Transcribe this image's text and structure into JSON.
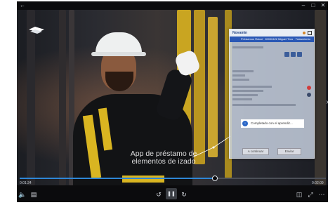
{
  "window": {
    "back_icon": "arrow-left-icon",
    "controls": [
      "minimize-icon",
      "maximize-icon",
      "close-icon"
    ]
  },
  "video": {
    "caption_line1": "App de préstamo de",
    "caption_line2": "elementos de izado",
    "progress": 0.635,
    "time_elapsed": "0:01:24",
    "time_total": "0:02:09",
    "accent_color": "#2e86d6"
  },
  "overlay_app": {
    "brand": "Novamin",
    "header_text": "Préstamos Rukat · 00000422 Miguel Tóro · Tratamiento",
    "notification": "Completado con el aprendiz...",
    "btn_left": "A continuar",
    "btn_right": "Enviar"
  },
  "player_controls": {
    "volume": "volume-icon",
    "subtitles": "subtitles-icon",
    "skip_back": "skip-back-10-icon",
    "play_pause": "pause-icon",
    "skip_forward": "skip-forward-30-icon",
    "mini_view": "mini-view-icon",
    "fullscreen": "fullscreen-icon",
    "more": "more-icon"
  }
}
